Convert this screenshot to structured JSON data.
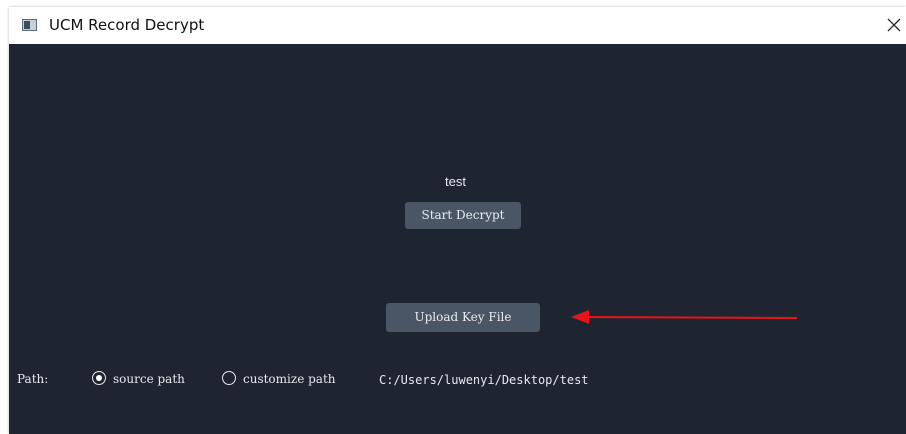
{
  "window": {
    "title": "UCM Record Decrypt",
    "close_glyph": "✕"
  },
  "main": {
    "status_text": "test",
    "start_decrypt_label": "Start Decrypt",
    "upload_key_label": "Upload Key File"
  },
  "path_row": {
    "label": "Path:",
    "options": [
      {
        "label": "source path",
        "selected": true
      },
      {
        "label": "customize path",
        "selected": false
      }
    ],
    "value": "C:/Users/luwenyi/Desktop/test"
  },
  "annotation": {
    "arrow_color": "#e8141a",
    "arrow_icon": "arrow-left-icon"
  },
  "colors": {
    "background": "#1e2530",
    "button": "#4a5566",
    "text": "#e6e9ee"
  }
}
